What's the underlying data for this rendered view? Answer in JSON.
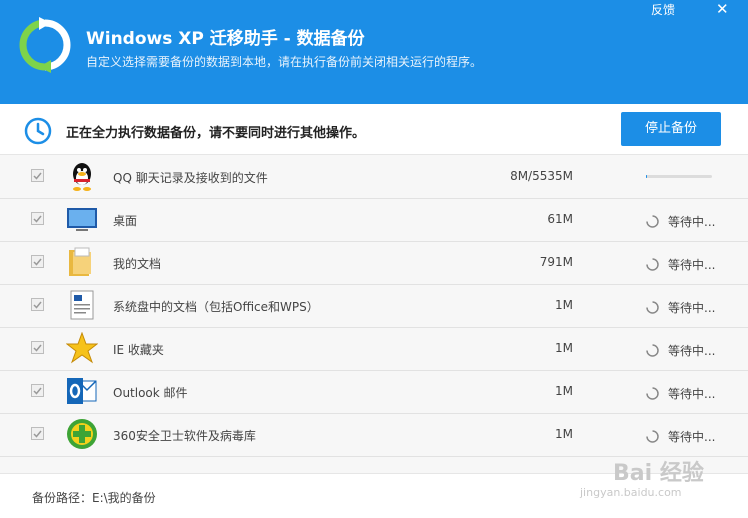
{
  "header": {
    "title": "Windows XP 迁移助手 - 数据备份",
    "subtitle": "自定义选择需要备份的数据到本地，请在执行备份前关闭相关运行的程序。",
    "feedback": "反馈",
    "close": "✕"
  },
  "status": {
    "message": "正在全力执行数据备份，请不要同时进行其他操作。",
    "stop_button": "停止备份"
  },
  "items": [
    {
      "icon": "qq-icon",
      "name": "QQ 聊天记录及接收到的文件",
      "size": "8M/5535M",
      "state": "progress",
      "progress": 0.0014
    },
    {
      "icon": "desktop-icon",
      "name": "桌面",
      "size": "61M",
      "state": "等待中..."
    },
    {
      "icon": "documents-folder-icon",
      "name": "我的文档",
      "size": "791M",
      "state": "等待中..."
    },
    {
      "icon": "office-document-icon",
      "name": "系统盘中的文档（包括Office和WPS）",
      "size": "1M",
      "state": "等待中..."
    },
    {
      "icon": "favorites-star-icon",
      "name": "IE 收藏夹",
      "size": "1M",
      "state": "等待中..."
    },
    {
      "icon": "outlook-icon",
      "name": "Outlook 邮件",
      "size": "1M",
      "state": "等待中..."
    },
    {
      "icon": "360-security-icon",
      "name": "360安全卫士软件及病毒库",
      "size": "1M",
      "state": "等待中..."
    }
  ],
  "footer": {
    "path": "备份路径：E:\\我的备份"
  },
  "watermark": {
    "brand": "Bai 经验",
    "url": "jingyan.baidu.com"
  },
  "colors": {
    "accent": "#1c8ee6",
    "header_bg": "#1c8ee6"
  }
}
